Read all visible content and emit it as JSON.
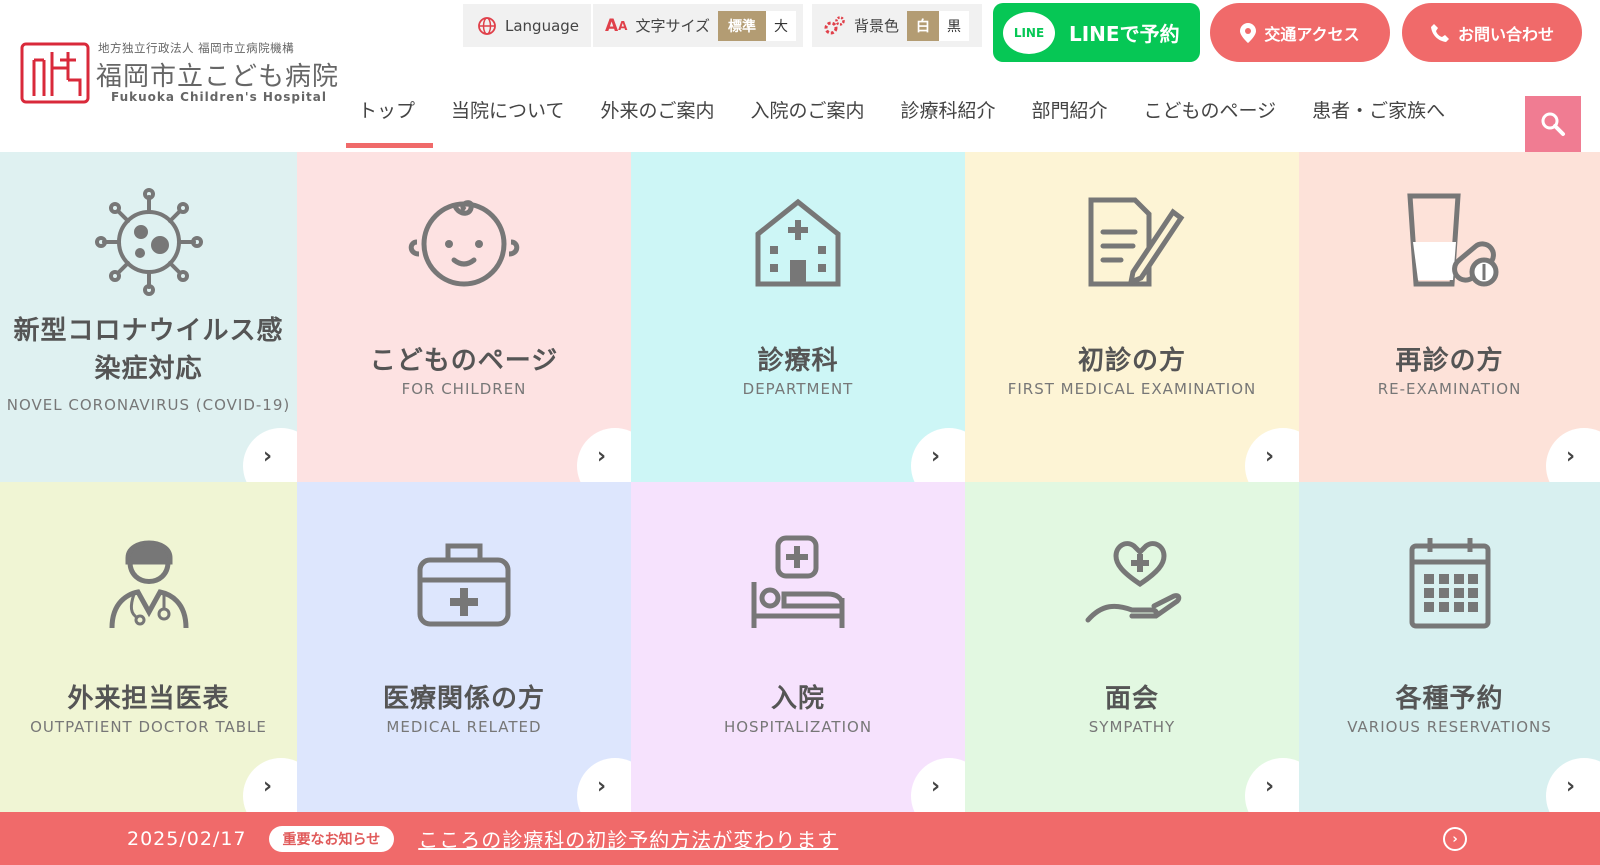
{
  "logo": {
    "org": "地方独立行政法人 福岡市立病院機構",
    "name": "福岡市立こども病院",
    "name_en": "Fukuoka Children's Hospital"
  },
  "utility": {
    "language_label": "Language",
    "font_size_label": "文字サイズ",
    "font_size_options": [
      "標準",
      "大"
    ],
    "font_size_selected": "標準",
    "bg_color_label": "背景色",
    "bg_color_options": [
      "白",
      "黒"
    ],
    "bg_color_selected": "白"
  },
  "actions": {
    "line_badge": "LINE",
    "line_label": "LINEで予約",
    "access_label": "交通アクセス",
    "contact_label": "お問い合わせ"
  },
  "nav": [
    {
      "label": "トップ",
      "active": true
    },
    {
      "label": "当院について"
    },
    {
      "label": "外来のご案内"
    },
    {
      "label": "入院のご案内"
    },
    {
      "label": "診療科紹介"
    },
    {
      "label": "部門紹介"
    },
    {
      "label": "こどものページ"
    },
    {
      "label": "患者・ご家族へ"
    }
  ],
  "tiles": [
    {
      "title": "新型コロナウイルス感染症対応",
      "title_l1": "新型コロナウイルス感",
      "title_l2": "染症対応",
      "subtitle": "NOVEL CORONAVIRUS (COVID-19)",
      "icon": "virus-icon",
      "color": "#dff1f1"
    },
    {
      "title": "こどものページ",
      "subtitle": "FOR CHILDREN",
      "icon": "baby-face-icon",
      "color": "#fde2e2"
    },
    {
      "title": "診療科",
      "subtitle": "DEPARTMENT",
      "icon": "hospital-building-icon",
      "color": "#cdf6f6"
    },
    {
      "title": "初診の方",
      "subtitle": "FIRST MEDICAL EXAMINATION",
      "icon": "document-pen-icon",
      "color": "#fdf4d5"
    },
    {
      "title": "再診の方",
      "subtitle": "RE-EXAMINATION",
      "icon": "medicine-cup-icon",
      "color": "#fde2d9"
    },
    {
      "title": "外来担当医表",
      "subtitle": "OUTPATIENT DOCTOR TABLE",
      "icon": "doctor-icon",
      "color": "#f0f5d4"
    },
    {
      "title": "医療関係の方",
      "subtitle": "MEDICAL RELATED",
      "icon": "medical-kit-icon",
      "color": "#dde6fd"
    },
    {
      "title": "入院",
      "subtitle": "HOSPITALIZATION",
      "icon": "hospital-bed-icon",
      "color": "#f6e2fd"
    },
    {
      "title": "面会",
      "subtitle": "SYMPATHY",
      "icon": "heart-hand-icon",
      "color": "#e2f8e1"
    },
    {
      "title": "各種予約",
      "subtitle": "VARIOUS RESERVATIONS",
      "icon": "calendar-icon",
      "color": "#d8f0f0"
    }
  ],
  "news": {
    "date": "2025/02/17",
    "badge": "重要なお知らせ",
    "text": "こころの診療科の初診予約方法が変わります"
  },
  "colors": {
    "accent": "#f06a6a",
    "line_green": "#06c755",
    "chip_gold": "#b39c73",
    "search_pink": "#f07c92",
    "icon_gray": "#7a7a7a"
  }
}
